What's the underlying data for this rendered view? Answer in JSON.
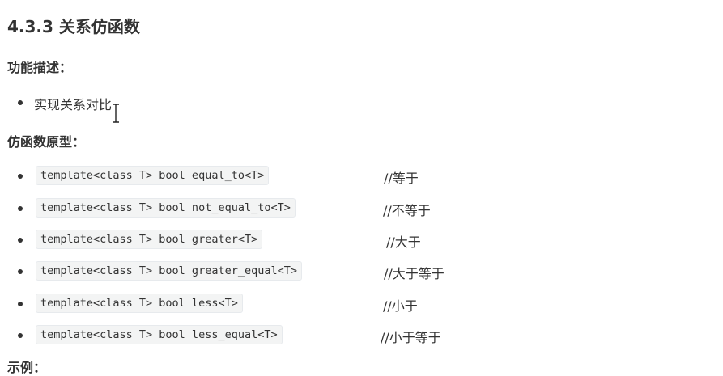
{
  "heading": "4.3.3 关系仿函数",
  "description": {
    "label": "功能描述：",
    "items": [
      "实现关系对比"
    ]
  },
  "prototypes": {
    "label": "仿函数原型：",
    "items": [
      {
        "code": "template<class T> bool equal_to<T>",
        "comment": "//等于"
      },
      {
        "code": "template<class T> bool not_equal_to<T>",
        "comment": "//不等于"
      },
      {
        "code": "template<class T> bool greater<T>",
        "comment": "//大于"
      },
      {
        "code": "template<class T> bool greater_equal<T>",
        "comment": "//大于等于"
      },
      {
        "code": "template<class T> bool less<T>",
        "comment": "//小于"
      },
      {
        "code": "template<class T> bool less_equal<T>",
        "comment": "//小于等于"
      }
    ]
  },
  "next_section_label": "示例："
}
